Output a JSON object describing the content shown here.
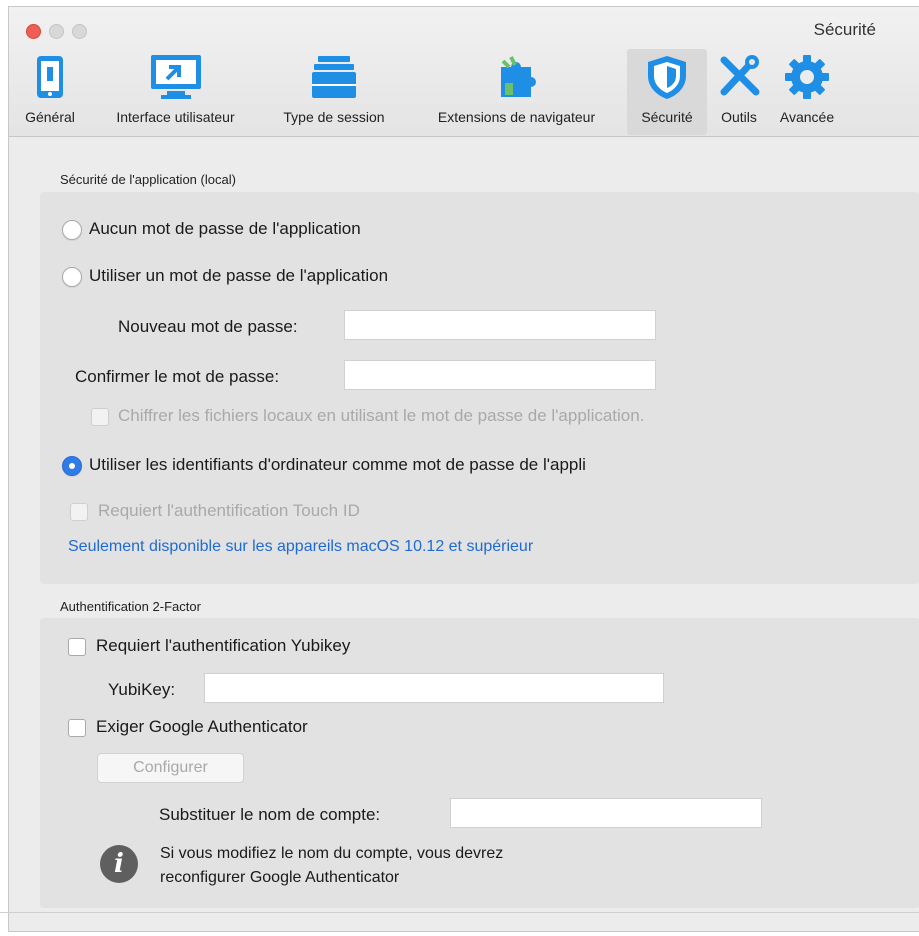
{
  "window": {
    "title": "Sécurité",
    "controls": [
      "close",
      "minimize",
      "zoom"
    ]
  },
  "toolbar": {
    "items": [
      {
        "label": "Général",
        "icon": "phone-icon",
        "color": "#1f8fe6"
      },
      {
        "label": "Interface utilisateur",
        "icon": "monitor-icon",
        "color": "#1f8fe6"
      },
      {
        "label": "Type de session",
        "icon": "drawer-icon",
        "color": "#1f8fe6"
      },
      {
        "label": "Extensions de navigateur",
        "icon": "puzzle-icon",
        "color": "#1f8fe6"
      },
      {
        "label": "Sécurité",
        "icon": "shield-icon",
        "color": "#1f8fe6",
        "active": true
      },
      {
        "label": "Outils",
        "icon": "tools-icon",
        "color": "#1f8fe6"
      },
      {
        "label": "Avancée",
        "icon": "gear-icon",
        "color": "#1f8fe6"
      }
    ]
  },
  "app_security": {
    "title": "Sécurité de l'application (local)",
    "option_none": "Aucun mot de passe de l'application",
    "option_password": "Utiliser un mot de passe de l'application",
    "new_password_label": "Nouveau mot de passe:",
    "new_password_value": "",
    "confirm_password_label": "Confirmer le mot de passe:",
    "confirm_password_value": "",
    "encrypt_label": "Chiffrer les fichiers locaux en utilisant le mot de passe de l'application.",
    "option_computer": "Utiliser les identifiants d'ordinateur comme mot de passe de l'appli",
    "touch_id_label": "Requiert l'authentification Touch ID",
    "note": "Seulement disponible sur les appareils macOS 10.12 et supérieur",
    "selected": "computer"
  },
  "two_factor": {
    "title": "Authentification 2-Factor",
    "yubikey_check": "Requiert l'authentification Yubikey",
    "yubikey_label": "YubiKey:",
    "yubikey_value": "",
    "google_check": "Exiger Google Authenticator",
    "configure_button": "Configurer",
    "account_label": "Substituer le nom de compte:",
    "account_value": "",
    "info_line1": "Si vous modifiez le nom du compte, vous devrez",
    "info_line2": "reconfigurer Google Authenticator"
  },
  "colors": {
    "accent": "#2f7be8",
    "link": "#1f6bd2",
    "close": "#ee5e56"
  }
}
